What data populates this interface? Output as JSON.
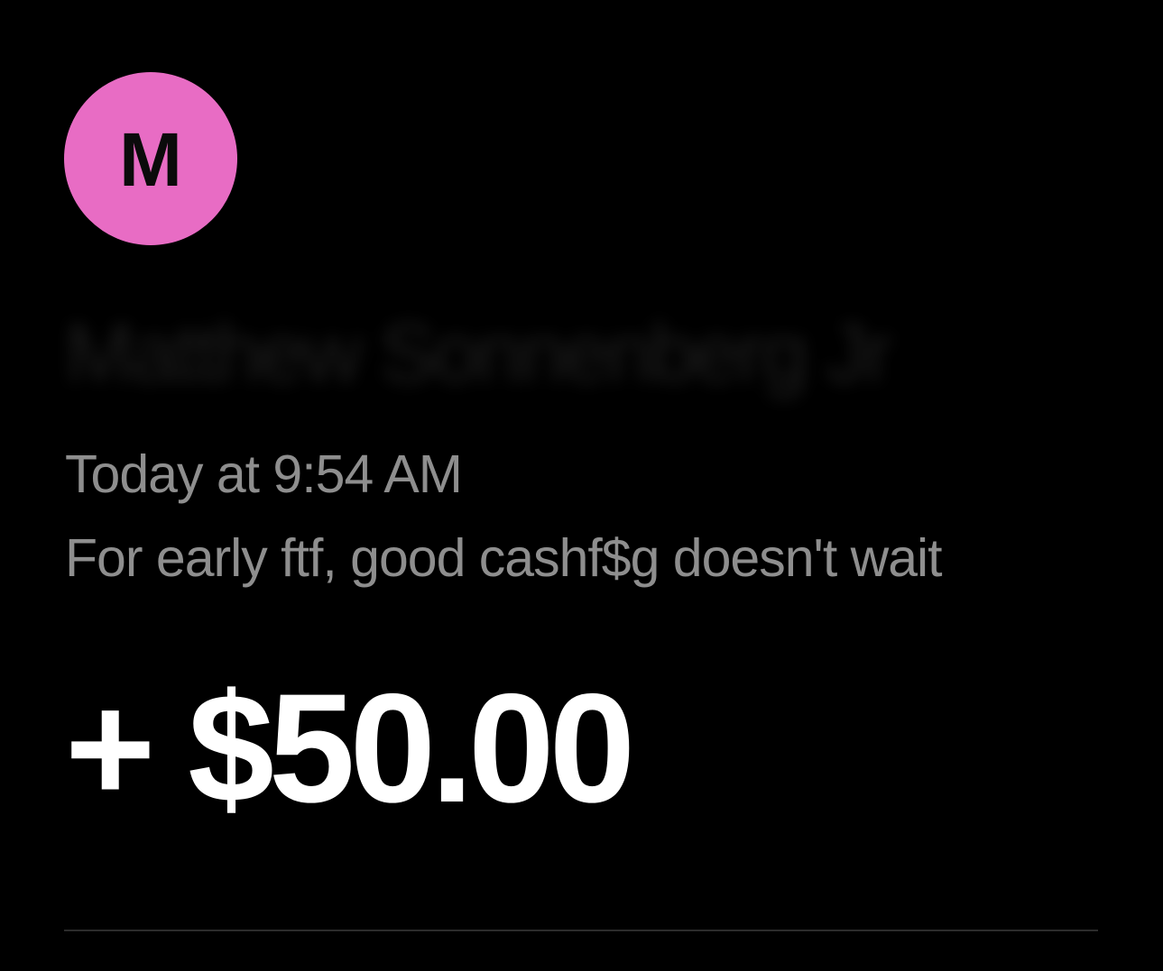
{
  "transaction": {
    "avatar_initial": "M",
    "avatar_color": "#E86CC4",
    "sender_name": "Matthew Sonnenberg Jr",
    "timestamp": "Today at 9:54 AM",
    "note": "For early ftf, good cashf$g doesn't wait",
    "amount": "+ $50.00"
  }
}
